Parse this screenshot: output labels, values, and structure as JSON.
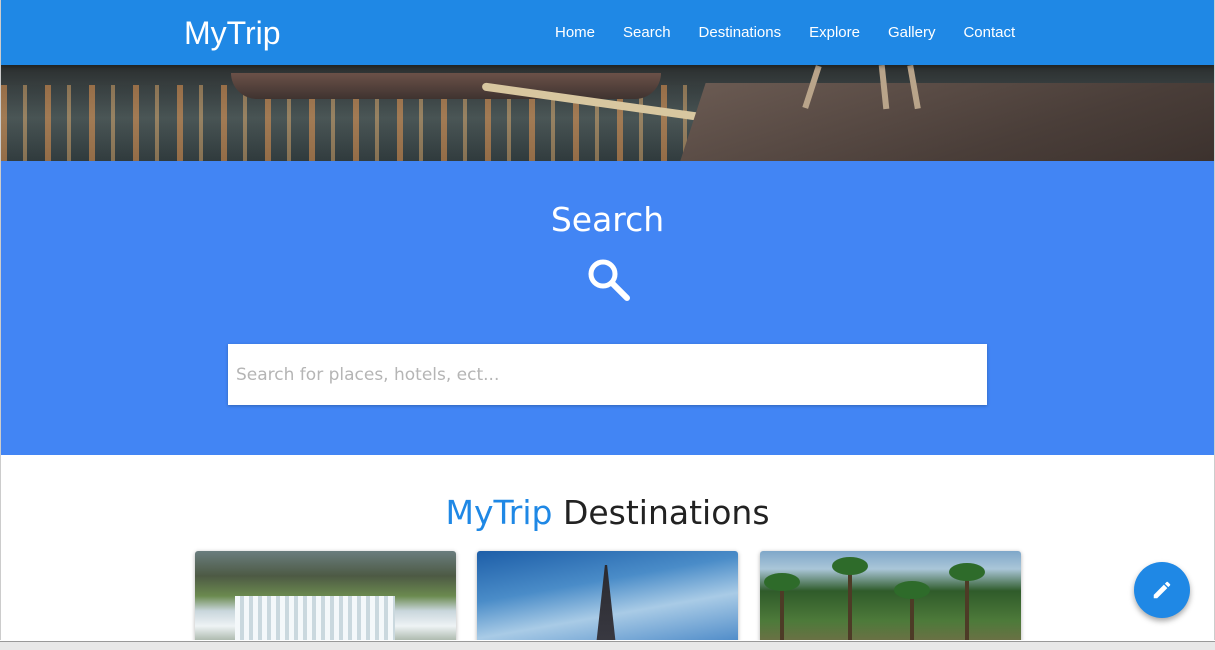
{
  "navbar": {
    "brand": "MyTrip",
    "links": [
      "Home",
      "Search",
      "Destinations",
      "Explore",
      "Gallery",
      "Contact"
    ]
  },
  "search": {
    "title": "Search",
    "placeholder": "Search for places, hotels, ect...",
    "icon": "search-icon"
  },
  "destinations": {
    "title_accent": "MyTrip",
    "title_rest": " Destinations",
    "cards": [
      "waterfall-photo",
      "eiffel-tower-photo",
      "palm-trees-photo"
    ]
  },
  "fab": {
    "icon": "pencil-icon"
  },
  "colors": {
    "navbar": "#1f88e5",
    "search_bg": "#4285f4",
    "accent": "#1f88e5"
  }
}
